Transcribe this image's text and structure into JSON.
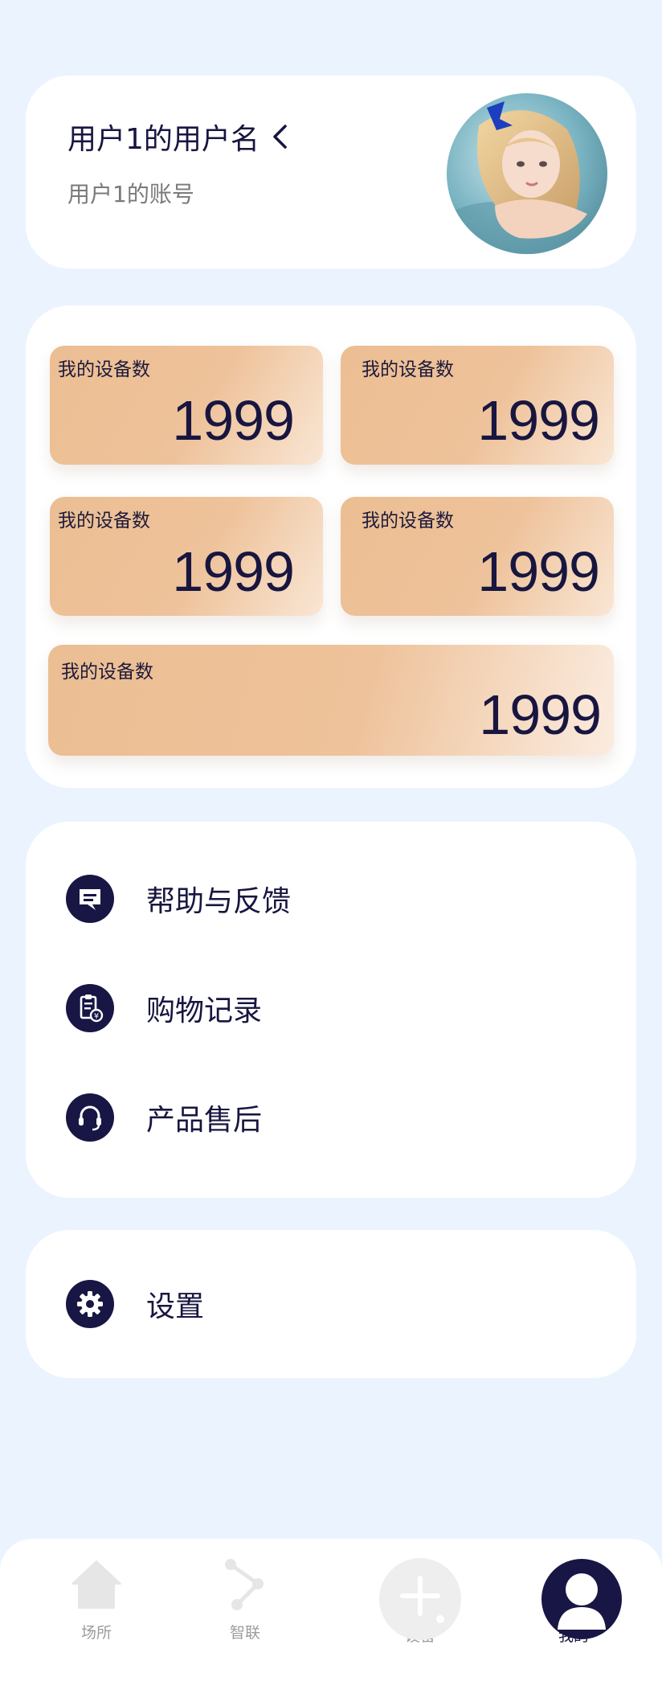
{
  "profile": {
    "username": "用户1的用户名",
    "account": "用户1的账号",
    "avatar_icon": "user-avatar-photo"
  },
  "stats": [
    {
      "label": "我的设备数",
      "value": "1999"
    },
    {
      "label": "我的设备数",
      "value": "1999"
    },
    {
      "label": "我的设备数",
      "value": "1999"
    },
    {
      "label": "我的设备数",
      "value": "1999"
    },
    {
      "label": "我的设备数",
      "value": "1999"
    }
  ],
  "menu": {
    "items": [
      {
        "label": "帮助与反馈",
        "icon": "feedback-icon"
      },
      {
        "label": "购物记录",
        "icon": "receipt-icon"
      },
      {
        "label": "产品售后",
        "icon": "headset-icon"
      }
    ],
    "settings": {
      "label": "设置",
      "icon": "gear-icon"
    }
  },
  "bottom_nav": {
    "items": [
      {
        "label": "场所",
        "icon": "home-icon"
      },
      {
        "label": "智联",
        "icon": "connect-icon"
      },
      {
        "label": "设备",
        "icon": "add-icon"
      },
      {
        "label": "我的",
        "icon": "user-icon"
      }
    ]
  },
  "colors": {
    "page_bg": "#ebf4fe",
    "card_bg": "#ffffff",
    "primary_dark": "#181644",
    "tile_gold": "#ecbe93",
    "muted_text": "#7a7a7a",
    "nav_inactive": "#d9d9d9"
  }
}
